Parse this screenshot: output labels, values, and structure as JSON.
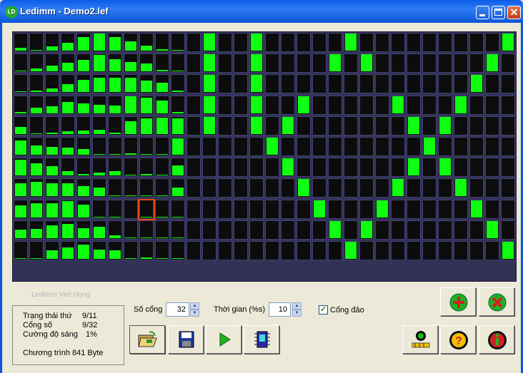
{
  "window": {
    "icon_text": "LD",
    "title": "Ledimm - Demo2.lef"
  },
  "led_matrix": {
    "rows": 11,
    "cols": 32,
    "lit_color": "#10ff10",
    "off_color": "#0c0c0c",
    "bar_levels_cols_0_10": [
      [
        0.15,
        0.05,
        0.25,
        0.45,
        0.8,
        1.0,
        0.8,
        0.55,
        0.3,
        0.1,
        0.05
      ],
      [
        0.05,
        0.15,
        0.35,
        0.5,
        0.65,
        0.95,
        0.7,
        0.55,
        0.45,
        0.1,
        0.05
      ],
      [
        0.05,
        0.1,
        0.2,
        0.45,
        0.7,
        0.85,
        0.85,
        0.85,
        0.65,
        0.55,
        0.1
      ],
      [
        0.1,
        0.35,
        0.4,
        0.65,
        0.6,
        0.5,
        0.45,
        1.0,
        0.9,
        0.75,
        0.1
      ],
      [
        0.4,
        0.05,
        0.1,
        0.15,
        0.2,
        0.25,
        0.1,
        0.75,
        0.9,
        0.95,
        0.9
      ],
      [
        0.85,
        0.55,
        0.45,
        0.4,
        0.35,
        0.05,
        0.05,
        0.1,
        0.05,
        0.05,
        0.95
      ],
      [
        0.9,
        0.7,
        0.55,
        0.25,
        0.1,
        0.15,
        0.25,
        0.05,
        0.1,
        0.05,
        0.6
      ],
      [
        0.75,
        0.85,
        0.75,
        0.75,
        0.6,
        0.5,
        0.05,
        0.05,
        0.05,
        0.05,
        0.5
      ],
      [
        0.7,
        0.85,
        0.85,
        0.95,
        0.75,
        0.05,
        0.05,
        0.0,
        0.05,
        0.05,
        0.05
      ],
      [
        0.5,
        0.55,
        0.75,
        0.85,
        0.6,
        0.65,
        0.15,
        0.05,
        0.05,
        0.05,
        0.05
      ],
      [
        0.05,
        0.05,
        0.5,
        0.65,
        0.85,
        0.55,
        0.5,
        0.05,
        0.1,
        0.05,
        0.05
      ]
    ],
    "full_lit_cells": [
      [
        0,
        12
      ],
      [
        1,
        12
      ],
      [
        2,
        12
      ],
      [
        3,
        12
      ],
      [
        4,
        12
      ],
      [
        0,
        15
      ],
      [
        1,
        15
      ],
      [
        2,
        15
      ],
      [
        3,
        15
      ],
      [
        4,
        15
      ],
      [
        0,
        21
      ],
      [
        1,
        20
      ],
      [
        1,
        22
      ],
      [
        2,
        29
      ],
      [
        3,
        18
      ],
      [
        3,
        24
      ],
      [
        3,
        28
      ],
      [
        4,
        17
      ],
      [
        4,
        25
      ],
      [
        4,
        27
      ],
      [
        5,
        16
      ],
      [
        5,
        26
      ],
      [
        6,
        17
      ],
      [
        6,
        25
      ],
      [
        6,
        27
      ],
      [
        7,
        18
      ],
      [
        7,
        24
      ],
      [
        7,
        28
      ],
      [
        8,
        19
      ],
      [
        8,
        23
      ],
      [
        8,
        29
      ],
      [
        9,
        20
      ],
      [
        9,
        22
      ],
      [
        9,
        30
      ],
      [
        0,
        31
      ],
      [
        1,
        30
      ],
      [
        10,
        21
      ],
      [
        10,
        31
      ]
    ],
    "selected_cell": [
      8,
      8
    ]
  },
  "watermark": "Ledimm Viet Hung",
  "status": {
    "rows": [
      {
        "label": "Trạng thái thứ",
        "value": "9/11"
      },
      {
        "label": "Cổng số",
        "value": "9/32"
      },
      {
        "label": "Cường độ sáng",
        "value": "1%"
      }
    ],
    "program": "Chương trình  841 Byte"
  },
  "controls": {
    "ports_label": "Số cổng",
    "ports_value": "32",
    "time_label": "Thời gian (%s)",
    "time_value": "10",
    "invert_label": "Cổng đảo",
    "invert_checked": true
  },
  "buttons": {
    "open": "open-file",
    "save": "save-file",
    "play": "play",
    "chip": "chip"
  }
}
